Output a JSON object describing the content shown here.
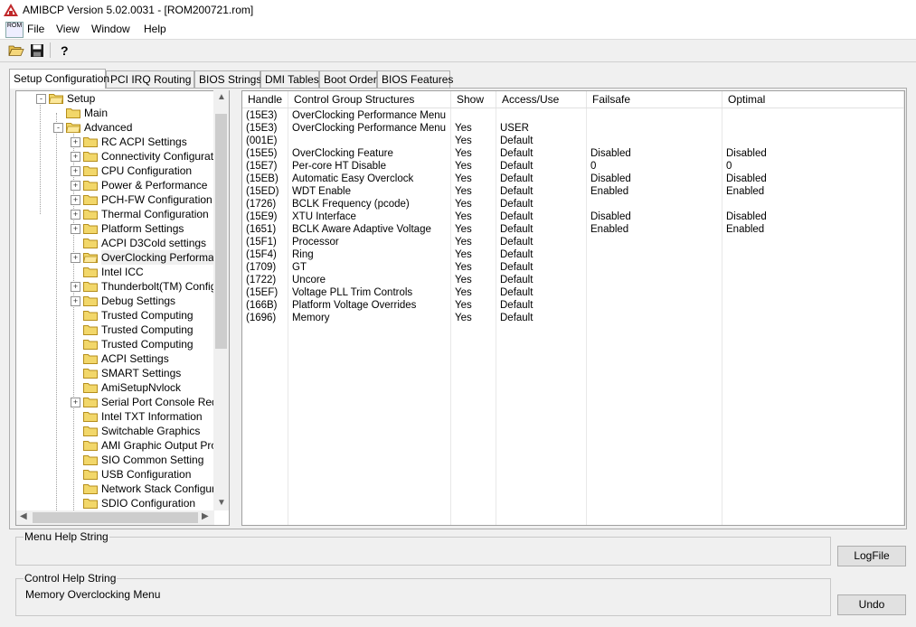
{
  "window": {
    "title": "AMIBCP Version 5.02.0031 - [ROM200721.rom]",
    "mdi_icon_text": "ROM"
  },
  "menu": {
    "items": [
      "File",
      "View",
      "Window",
      "Help"
    ]
  },
  "toolbar": {
    "open_icon": "folder-open-icon",
    "save_icon": "save-icon",
    "help_icon": "help-icon"
  },
  "tabs": [
    "Setup Configuration",
    "PCI IRQ Routing",
    "BIOS Strings",
    "DMI Tables",
    "Boot Order",
    "BIOS Features"
  ],
  "active_tab": "Setup Configuration",
  "tree": {
    "items": [
      {
        "label": "Setup",
        "level": 0,
        "expander": "-",
        "open": true
      },
      {
        "label": "Main",
        "level": 1,
        "expander": "",
        "open": false
      },
      {
        "label": "Advanced",
        "level": 1,
        "expander": "-",
        "open": true
      },
      {
        "label": "RC ACPI Settings",
        "level": 2,
        "expander": "+",
        "open": false
      },
      {
        "label": "Connectivity Configuration",
        "level": 2,
        "expander": "+",
        "open": false
      },
      {
        "label": "CPU Configuration",
        "level": 2,
        "expander": "+",
        "open": false
      },
      {
        "label": "Power & Performance",
        "level": 2,
        "expander": "+",
        "open": false
      },
      {
        "label": "PCH-FW Configuration",
        "level": 2,
        "expander": "+",
        "open": false
      },
      {
        "label": "Thermal Configuration",
        "level": 2,
        "expander": "+",
        "open": false
      },
      {
        "label": "Platform Settings",
        "level": 2,
        "expander": "+",
        "open": false
      },
      {
        "label": "ACPI D3Cold settings",
        "level": 2,
        "expander": "",
        "open": false
      },
      {
        "label": "OverClocking Performance",
        "level": 2,
        "expander": "+",
        "open": true,
        "selected": true
      },
      {
        "label": "Intel ICC",
        "level": 2,
        "expander": "",
        "open": false
      },
      {
        "label": "Thunderbolt(TM) Configuration",
        "level": 2,
        "expander": "+",
        "open": false
      },
      {
        "label": "Debug Settings",
        "level": 2,
        "expander": "+",
        "open": false
      },
      {
        "label": "Trusted Computing",
        "level": 2,
        "expander": "",
        "open": false
      },
      {
        "label": "Trusted Computing",
        "level": 2,
        "expander": "",
        "open": false
      },
      {
        "label": "Trusted Computing",
        "level": 2,
        "expander": "",
        "open": false
      },
      {
        "label": "ACPI Settings",
        "level": 2,
        "expander": "",
        "open": false
      },
      {
        "label": "SMART Settings",
        "level": 2,
        "expander": "",
        "open": false
      },
      {
        "label": "AmiSetupNvlock",
        "level": 2,
        "expander": "",
        "open": false
      },
      {
        "label": "Serial Port Console Redirection",
        "level": 2,
        "expander": "+",
        "open": false
      },
      {
        "label": "Intel TXT Information",
        "level": 2,
        "expander": "",
        "open": false
      },
      {
        "label": "Switchable Graphics",
        "level": 2,
        "expander": "",
        "open": false
      },
      {
        "label": "AMI Graphic Output Protocol",
        "level": 2,
        "expander": "",
        "open": false
      },
      {
        "label": "SIO Common Setting",
        "level": 2,
        "expander": "",
        "open": false
      },
      {
        "label": "USB Configuration",
        "level": 2,
        "expander": "",
        "open": false
      },
      {
        "label": "Network Stack Configuration",
        "level": 2,
        "expander": "",
        "open": false
      },
      {
        "label": "SDIO Configuration",
        "level": 2,
        "expander": "",
        "open": false
      }
    ]
  },
  "table": {
    "columns": [
      "Handle",
      "Control Group Structures",
      "Show",
      "Access/Use",
      "Failsafe",
      "Optimal"
    ],
    "rows": [
      [
        "(15E3)",
        "OverClocking Performance Menu",
        "",
        "",
        "",
        ""
      ],
      [
        "(15E3)",
        "OverClocking Performance Menu",
        "Yes",
        "USER",
        "",
        ""
      ],
      [
        "(001E)",
        "",
        "Yes",
        "Default",
        "",
        ""
      ],
      [
        "(15E5)",
        "OverClocking Feature",
        "Yes",
        "Default",
        "Disabled",
        "Disabled"
      ],
      [
        "(15E7)",
        "Per-core HT Disable",
        "Yes",
        "Default",
        "0",
        "0"
      ],
      [
        "(15EB)",
        "Automatic Easy Overclock",
        "Yes",
        "Default",
        "Disabled",
        "Disabled"
      ],
      [
        "(15ED)",
        "WDT Enable",
        "Yes",
        "Default",
        "Enabled",
        "Enabled"
      ],
      [
        "(1726)",
        "BCLK Frequency (pcode)",
        "Yes",
        "Default",
        "",
        ""
      ],
      [
        "(15E9)",
        "XTU Interface",
        "Yes",
        "Default",
        "Disabled",
        "Disabled"
      ],
      [
        "(1651)",
        "BCLK Aware Adaptive Voltage",
        "Yes",
        "Default",
        "Enabled",
        "Enabled"
      ],
      [
        "(15F1)",
        "Processor",
        "Yes",
        "Default",
        "",
        ""
      ],
      [
        "(15F4)",
        "Ring",
        "Yes",
        "Default",
        "",
        ""
      ],
      [
        "(1709)",
        "GT",
        "Yes",
        "Default",
        "",
        ""
      ],
      [
        "(1722)",
        "Uncore",
        "Yes",
        "Default",
        "",
        ""
      ],
      [
        "(15EF)",
        "Voltage PLL Trim Controls",
        "Yes",
        "Default",
        "",
        ""
      ],
      [
        "(166B)",
        "Platform Voltage Overrides",
        "Yes",
        "Default",
        "",
        ""
      ],
      [
        "(1696)",
        "Memory",
        "Yes",
        "Default",
        "",
        ""
      ]
    ]
  },
  "menu_help": {
    "label": "Menu Help String",
    "value": ""
  },
  "control_help": {
    "label": "Control Help String",
    "value": "Memory Overclocking Menu"
  },
  "buttons": {
    "logfile": "LogFile",
    "undo": "Undo"
  }
}
